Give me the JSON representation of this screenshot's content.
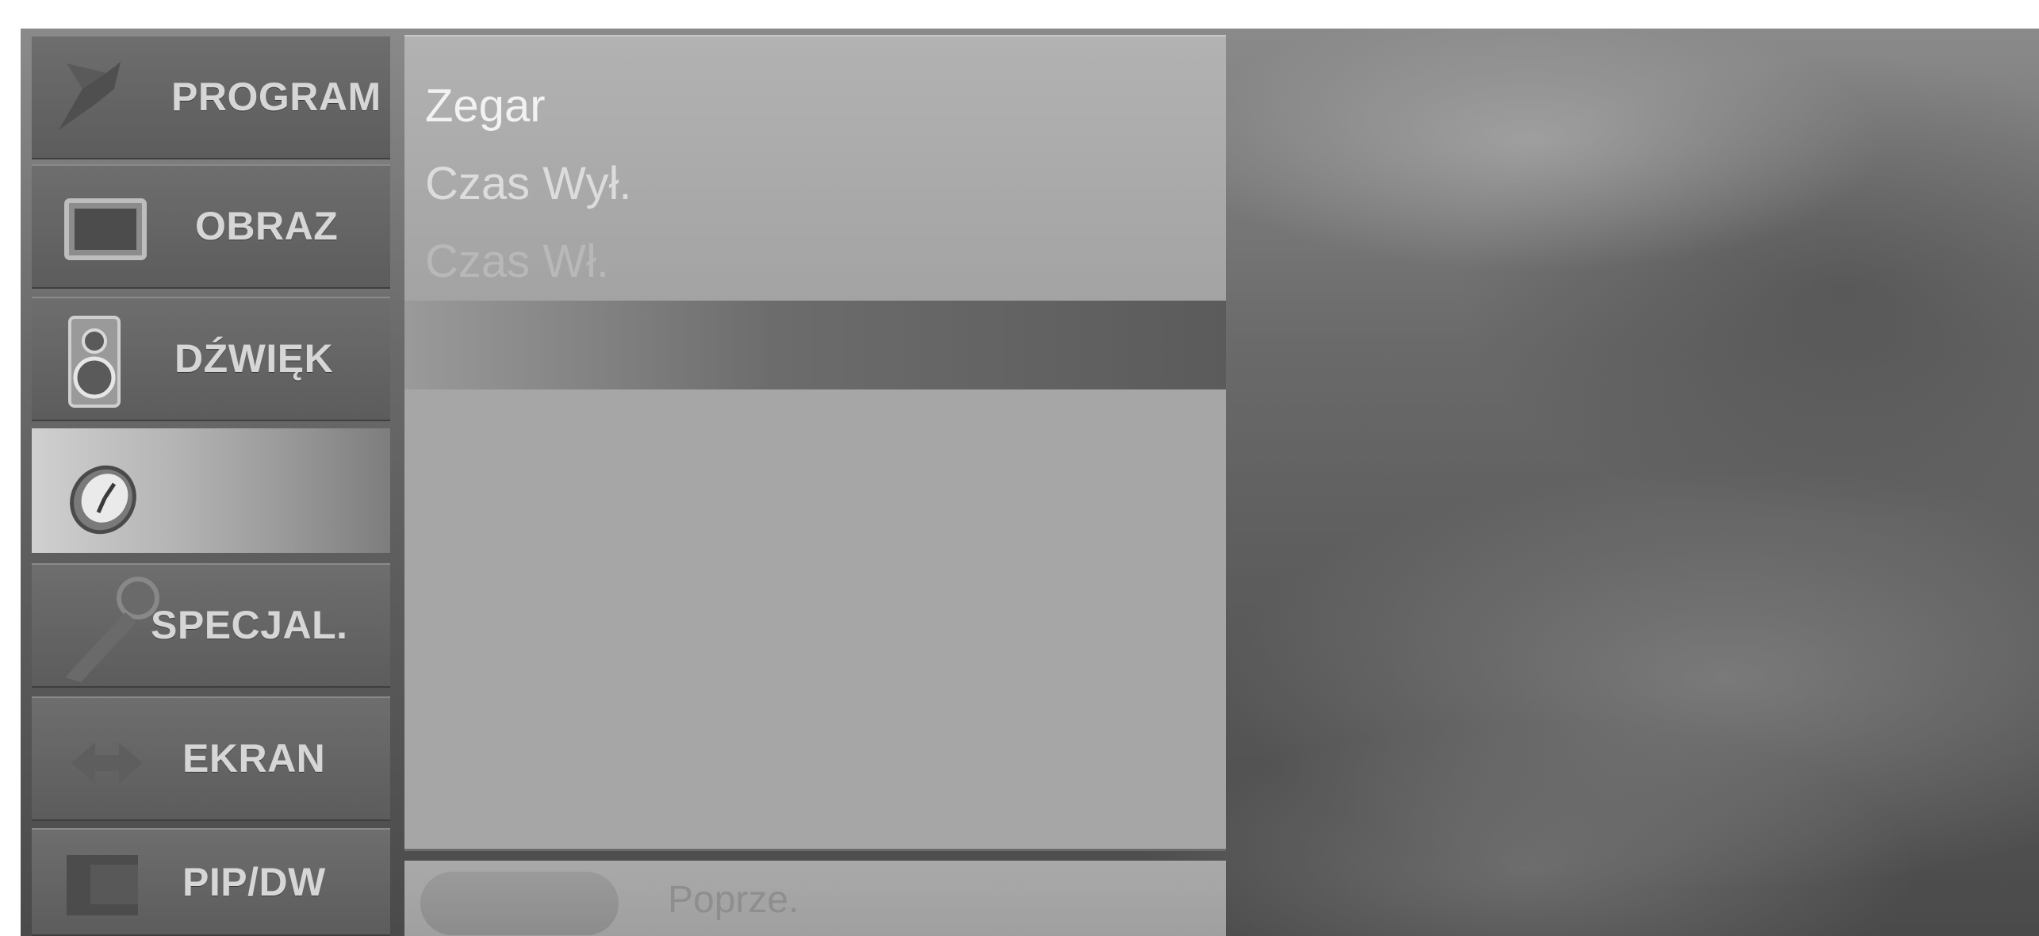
{
  "sidebar": {
    "items": [
      {
        "label": "PROGRAM",
        "icon": "satellite-dish-icon"
      },
      {
        "label": "OBRAZ",
        "icon": "tv-screen-icon"
      },
      {
        "label": "DŹWIĘK",
        "icon": "speaker-icon"
      },
      {
        "label": "",
        "icon": "clock-icon",
        "active": true
      },
      {
        "label": "SPECJAL.",
        "icon": "key-icon"
      },
      {
        "label": "EKRAN",
        "icon": "arrows-icon"
      },
      {
        "label": "PIP/DW",
        "icon": "pip-window-icon"
      }
    ]
  },
  "submenu": {
    "items": [
      {
        "label": "Zegar",
        "state": "highlighted"
      },
      {
        "label": "Czas Wył.",
        "state": "normal"
      },
      {
        "label": "Czas Wł.",
        "state": "dimmed"
      }
    ]
  },
  "footer": {
    "label": "Poprze."
  },
  "colors": {
    "background": "#6a6a6a",
    "sidebar_item": "#666666",
    "sidebar_active": "#c2c2c2",
    "panel": "#a6a6a6",
    "text_highlight": "#f2f2f2",
    "text_normal": "#dcdcdc",
    "text_dim": "#b8b8b8"
  }
}
